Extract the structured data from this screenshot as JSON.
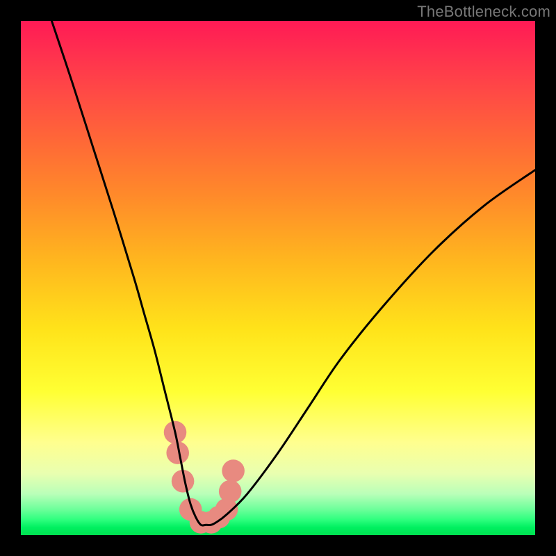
{
  "watermark": {
    "text": "TheBottleneck.com"
  },
  "chart_data": {
    "type": "line",
    "title": "",
    "xlabel": "",
    "ylabel": "",
    "xlim": [
      0,
      100
    ],
    "ylim": [
      0,
      100
    ],
    "grid": false,
    "series": [
      {
        "name": "bottleneck-curve",
        "x": [
          6,
          10,
          14,
          18,
          22,
          24,
          26,
          28,
          30,
          31,
          32,
          33,
          34,
          35,
          36,
          37,
          38,
          40,
          44,
          50,
          56,
          62,
          70,
          80,
          90,
          100
        ],
        "values": [
          100,
          88,
          75.5,
          63,
          50,
          43,
          36,
          28,
          20,
          15,
          10,
          6,
          3.5,
          2,
          2,
          2,
          2.5,
          4,
          8,
          16,
          25,
          34,
          44,
          55,
          64,
          71
        ]
      }
    ],
    "annotations": {
      "marker_band": {
        "description": "Salmon rounded markers along curve near its minimum",
        "x": [
          30,
          30.5,
          31.5,
          33,
          35,
          37,
          38.5,
          40,
          40.7,
          41.3
        ],
        "values": [
          20,
          16,
          10.5,
          5,
          2.5,
          2.5,
          3.5,
          5,
          8.5,
          12.5
        ],
        "color": "#e88a80",
        "radius_pct": 2.2
      }
    },
    "background": {
      "type": "vertical-gradient",
      "stops": [
        {
          "offset": 0.0,
          "color": "#ff1a55"
        },
        {
          "offset": 0.6,
          "color": "#ffe31a"
        },
        {
          "offset": 0.82,
          "color": "#ffff8f"
        },
        {
          "offset": 0.95,
          "color": "#6cff9a"
        },
        {
          "offset": 1.0,
          "color": "#00e050"
        }
      ]
    }
  }
}
